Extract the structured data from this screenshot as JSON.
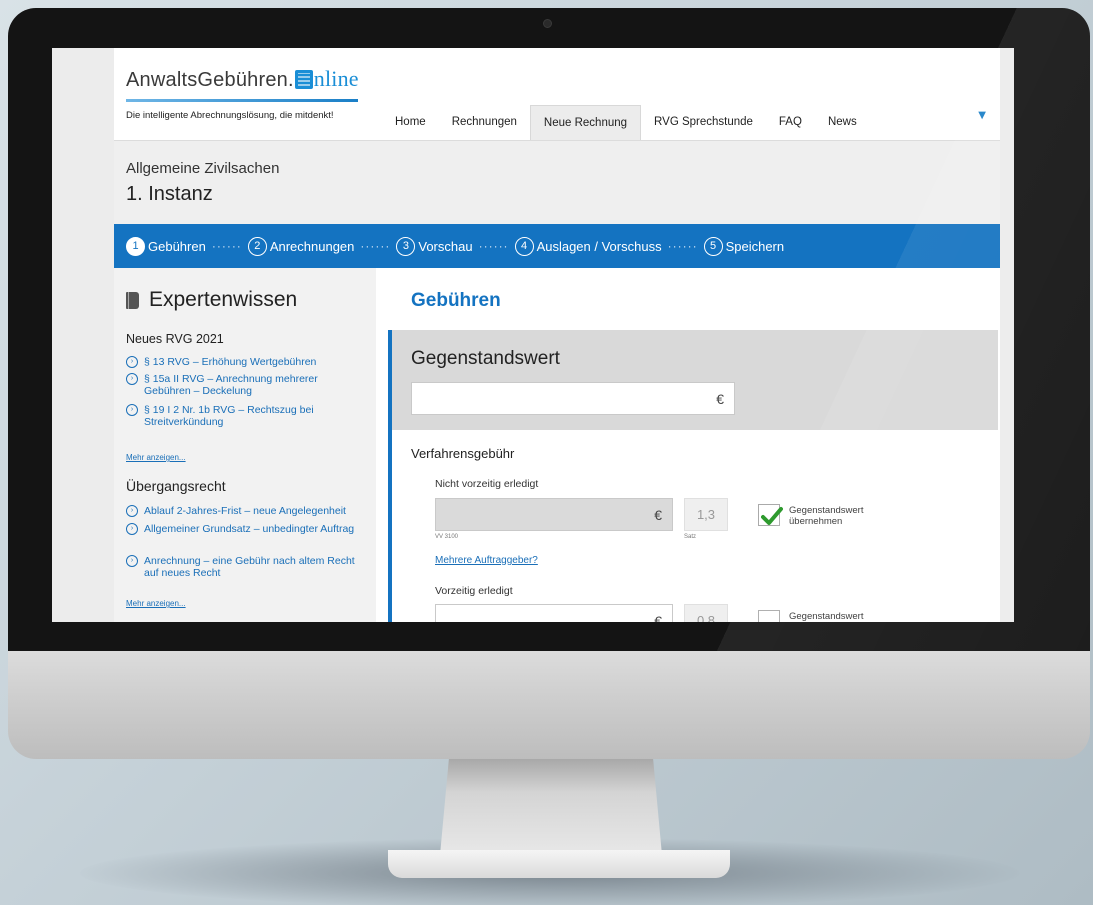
{
  "header": {
    "logo_text": "AnwaltsGebühren.",
    "logo_suffix": "nline",
    "tagline": "Die intelligente Abrechnungslösung, die mitdenkt!",
    "nav": [
      "Home",
      "Rechnungen",
      "Neue Rechnung",
      "RVG Sprechstunde",
      "FAQ",
      "News"
    ],
    "active_nav": "Neue Rechnung",
    "caret": "▼"
  },
  "title": {
    "category": "Allgemeine Zivilsachen",
    "instance": "1. Instanz"
  },
  "steps": [
    {
      "num": "1",
      "label": "Gebühren"
    },
    {
      "num": "2",
      "label": "Anrechnungen"
    },
    {
      "num": "3",
      "label": "Vorschau"
    },
    {
      "num": "4",
      "label": "Auslagen / Vorschuss"
    },
    {
      "num": "5",
      "label": "Speichern"
    }
  ],
  "steps_dots": "······",
  "sidebar": {
    "title": "Expertenwissen",
    "section1": "Neues RVG 2021",
    "links1": [
      "§ 13 RVG – Erhöhung Wertgebühren",
      "§ 15a II RVG – Anrechnung mehrerer Gebühren – Deckelung",
      "§ 19 I 2 Nr. 1b RVG – Rechtszug bei Streitverkündung"
    ],
    "more1": "Mehr anzeigen...",
    "section2": "Übergangsrecht",
    "links2": [
      "Ablauf 2-Jahres-Frist – neue Angelegenheit",
      "Allgemeiner Grundsatz – unbedingter Auftrag",
      "Anrechnung – eine Gebühr nach altem Recht auf neues Recht"
    ],
    "more2": "Mehr anzeigen..."
  },
  "main": {
    "title": "Gebühren",
    "gegenstandswert_title": "Gegenstandswert",
    "currency": "€",
    "verfahrensgebuehr": "Verfahrensgebühr",
    "nicht_vorzeitig": "Nicht vorzeitig erledigt",
    "vv_label": "VV 3100",
    "satz_label": "Satz",
    "satz_value_1": "1,3",
    "checkbox_label": "Gegenstandswert übernehmen",
    "checkbox_label_2": "Gegenstandswert",
    "mehrere_link": "Mehrere Auftraggeber?",
    "vorzeitig": "Vorzeitig erledigt",
    "satz_value_2": "0,8"
  },
  "colors": {
    "brand_blue": "#1473c1",
    "check_green": "#2e9a2e"
  }
}
